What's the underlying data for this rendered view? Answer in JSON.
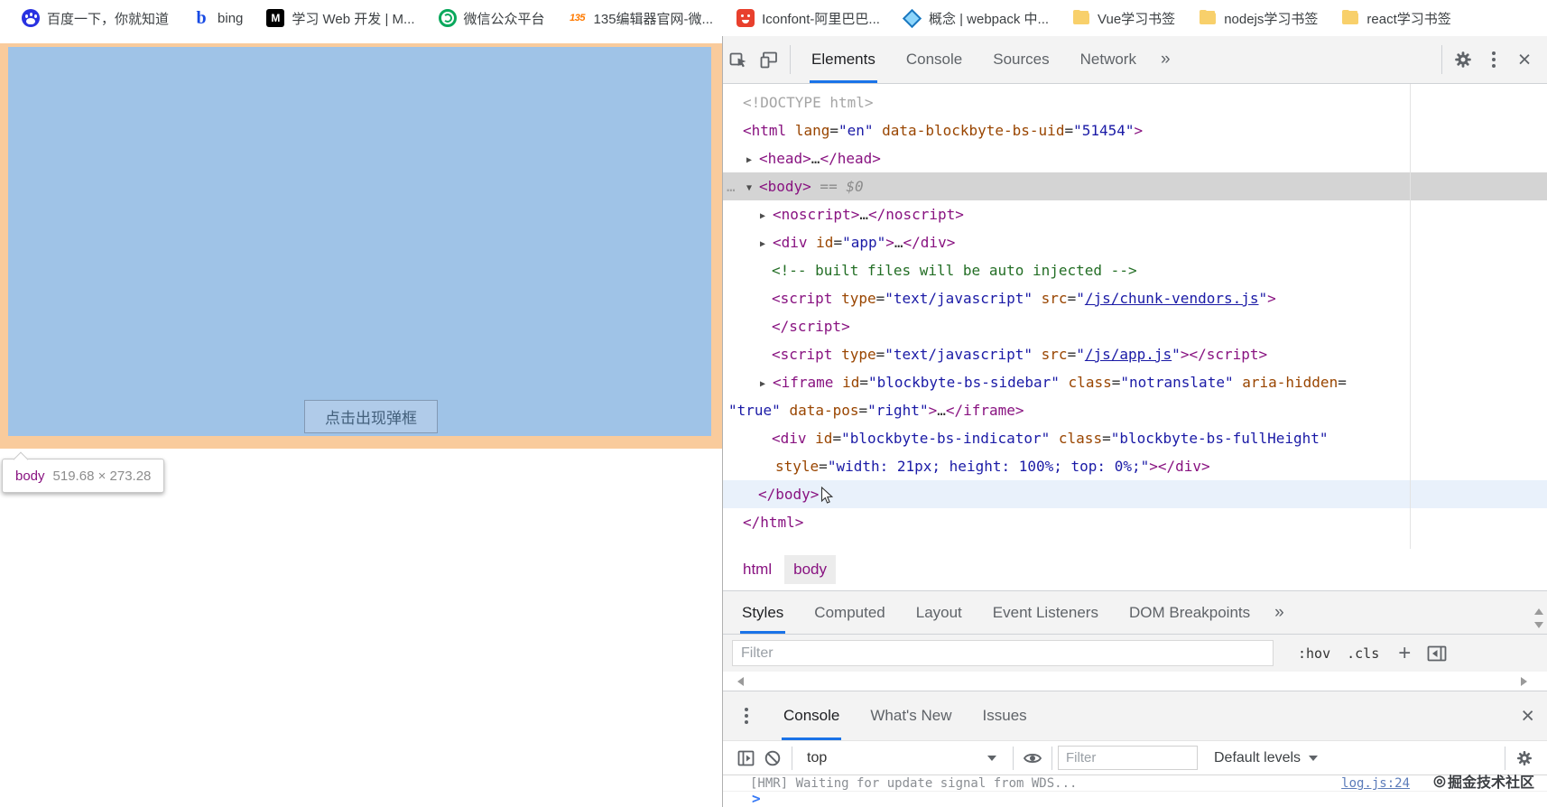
{
  "browser": {
    "bookmarks": [
      {
        "label": "百度一下，你就知道",
        "icon": "baidu"
      },
      {
        "label": "bing",
        "icon": "bing"
      },
      {
        "label": "学习 Web 开发 | M...",
        "icon": "mdn"
      },
      {
        "label": "微信公众平台",
        "icon": "wechat"
      },
      {
        "label": "135编辑器官网-微...",
        "icon": "135"
      },
      {
        "label": "Iconfont-阿里巴巴...",
        "icon": "iconfont"
      },
      {
        "label": "概念 | webpack 中...",
        "icon": "webpack"
      },
      {
        "label": "Vue学习书签",
        "icon": "folder"
      },
      {
        "label": "nodejs学习书签",
        "icon": "folder"
      },
      {
        "label": "react学习书签",
        "icon": "folder"
      }
    ]
  },
  "page": {
    "button_label": "点击出现弹框",
    "overlay": {
      "content_color": "#9fc3e7",
      "margin_color": "#f9cb9c"
    },
    "tooltip": {
      "tag": "body",
      "dims": "519.68 × 273.28"
    }
  },
  "devtools": {
    "main_tabs": [
      "Elements",
      "Console",
      "Sources",
      "Network"
    ],
    "active_main_tab": "Elements",
    "overflow_chevron": "»",
    "elements_panel": {
      "breadcrumbs": [
        {
          "label": "html",
          "selected": false
        },
        {
          "label": "body",
          "selected": true
        }
      ],
      "code_lines": [
        {
          "pad": 22,
          "seg": [
            [
              "g",
              "<!DOCTYPE html>"
            ]
          ]
        },
        {
          "pad": 22,
          "seg": [
            [
              "t",
              "<html"
            ],
            [
              "p",
              " "
            ],
            [
              "a",
              "lang"
            ],
            [
              "p",
              "="
            ],
            [
              "v",
              "\"en\""
            ],
            [
              "p",
              " "
            ],
            [
              "a",
              "data-blockbyte-bs-uid"
            ],
            [
              "p",
              "="
            ],
            [
              "v",
              "\"51454\""
            ],
            [
              "t",
              ">"
            ]
          ]
        },
        {
          "pad": 26,
          "arrow": "r",
          "seg": [
            [
              "t",
              "<head>"
            ],
            [
              "p",
              "…"
            ],
            [
              "t",
              "</head>"
            ]
          ]
        },
        {
          "pad": 26,
          "arrow": "d",
          "gutter": true,
          "state": "selected",
          "seg": [
            [
              "t",
              "<body>"
            ],
            [
              "d",
              " == $0"
            ]
          ]
        },
        {
          "pad": 41,
          "arrow": "r",
          "seg": [
            [
              "t",
              "<noscript>"
            ],
            [
              "p",
              "…"
            ],
            [
              "t",
              "</noscript>"
            ]
          ]
        },
        {
          "pad": 41,
          "arrow": "r",
          "seg": [
            [
              "t",
              "<div"
            ],
            [
              "p",
              " "
            ],
            [
              "a",
              "id"
            ],
            [
              "p",
              "="
            ],
            [
              "v",
              "\"app\""
            ],
            [
              "t",
              ">"
            ],
            [
              "p",
              "…"
            ],
            [
              "t",
              "</div>"
            ]
          ]
        },
        {
          "pad": 54,
          "seg": [
            [
              "c",
              "<!-- built files will be auto injected -->"
            ]
          ]
        },
        {
          "pad": 54,
          "seg": [
            [
              "t",
              "<script"
            ],
            [
              "p",
              " "
            ],
            [
              "a",
              "type"
            ],
            [
              "p",
              "="
            ],
            [
              "v",
              "\"text/javascript\""
            ],
            [
              "p",
              " "
            ],
            [
              "a",
              "src"
            ],
            [
              "p",
              "="
            ],
            [
              "v",
              "\""
            ],
            [
              "l",
              "/js/chunk-vendors.js"
            ],
            [
              "v",
              "\""
            ],
            [
              "t",
              ">"
            ]
          ]
        },
        {
          "pad": 54,
          "seg": [
            [
              "t",
              "</script>"
            ]
          ]
        },
        {
          "pad": 54,
          "seg": [
            [
              "t",
              "<script"
            ],
            [
              "p",
              " "
            ],
            [
              "a",
              "type"
            ],
            [
              "p",
              "="
            ],
            [
              "v",
              "\"text/javascript\""
            ],
            [
              "p",
              " "
            ],
            [
              "a",
              "src"
            ],
            [
              "p",
              "="
            ],
            [
              "v",
              "\""
            ],
            [
              "l",
              "/js/app.js"
            ],
            [
              "v",
              "\""
            ],
            [
              "t",
              "></script>"
            ]
          ]
        },
        {
          "pad": 41,
          "arrow": "r",
          "seg": [
            [
              "t",
              "<iframe"
            ],
            [
              "p",
              " "
            ],
            [
              "a",
              "id"
            ],
            [
              "p",
              "="
            ],
            [
              "v",
              "\"blockbyte-bs-sidebar\""
            ],
            [
              "p",
              " "
            ],
            [
              "a",
              "class"
            ],
            [
              "p",
              "="
            ],
            [
              "v",
              "\"notranslate\""
            ],
            [
              "p",
              " "
            ],
            [
              "a",
              "aria-hidden"
            ],
            [
              "p",
              "="
            ]
          ]
        },
        {
          "pad": 6,
          "seg": [
            [
              "v",
              "\"true\""
            ],
            [
              "p",
              " "
            ],
            [
              "a",
              "data-pos"
            ],
            [
              "p",
              "="
            ],
            [
              "v",
              "\"right\""
            ],
            [
              "t",
              ">"
            ],
            [
              "p",
              "…"
            ],
            [
              "t",
              "</iframe>"
            ]
          ]
        },
        {
          "pad": 54,
          "seg": [
            [
              "t",
              "<div"
            ],
            [
              "p",
              " "
            ],
            [
              "a",
              "id"
            ],
            [
              "p",
              "="
            ],
            [
              "v",
              "\"blockbyte-bs-indicator\""
            ],
            [
              "p",
              " "
            ],
            [
              "a",
              "class"
            ],
            [
              "p",
              "="
            ],
            [
              "v",
              "\"blockbyte-bs-fullHeight\""
            ]
          ]
        },
        {
          "pad": 58,
          "seg": [
            [
              "a",
              "style"
            ],
            [
              "p",
              "="
            ],
            [
              "v",
              "\"width: 21px; height: 100%; top: 0%;\""
            ],
            [
              "t",
              "></div>"
            ]
          ]
        },
        {
          "pad": 39,
          "state": "hovered",
          "cursor": true,
          "seg": [
            [
              "t",
              "</body>"
            ]
          ]
        },
        {
          "pad": 22,
          "seg": [
            [
              "t",
              "</html>"
            ]
          ]
        }
      ]
    },
    "styles_panel": {
      "tabs": [
        "Styles",
        "Computed",
        "Layout",
        "Event Listeners",
        "DOM Breakpoints"
      ],
      "active_tab": "Styles",
      "overflow_chevron": "»",
      "filter_placeholder": "Filter",
      "pseudo_button": ":hov",
      "class_button": ".cls",
      "add_rule_button": "+"
    },
    "drawer": {
      "tabs": [
        "Console",
        "What's New",
        "Issues"
      ],
      "active_tab": "Console",
      "toolbar": {
        "context": "top",
        "filter_placeholder": "Filter",
        "levels": "Default levels"
      },
      "message": {
        "text": "[HMR] Waiting for update signal from WDS...",
        "source": "log.js:24"
      },
      "prompt": ">"
    }
  },
  "watermark": {
    "badge": "◎",
    "text": "掘金技术社区"
  }
}
